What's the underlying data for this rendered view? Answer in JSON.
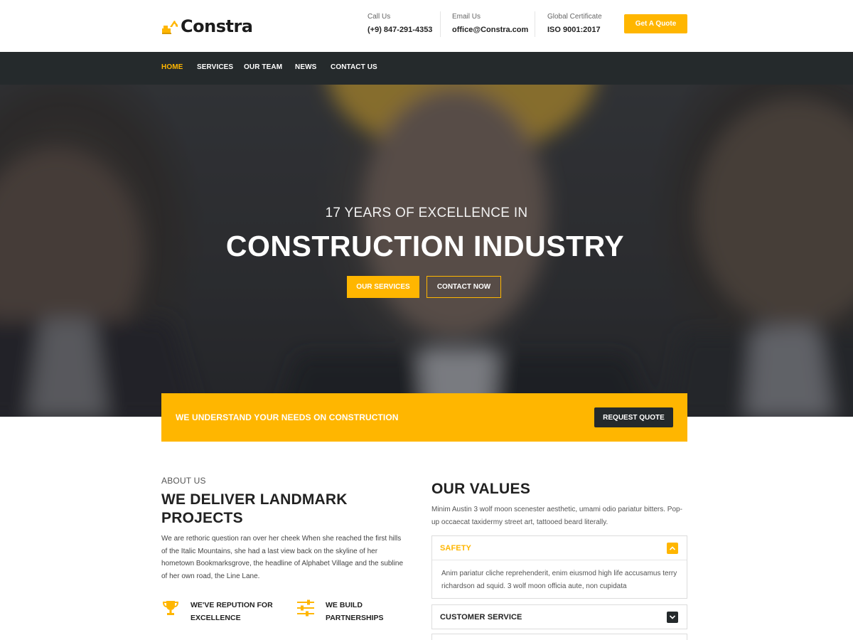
{
  "brand": {
    "name": "Constra",
    "accent": "#ffb600",
    "dark": "#252a2c",
    "icon": "excavator-logo-icon"
  },
  "contact": [
    {
      "label": "Call Us",
      "value": "(+9) 847-291-4353"
    },
    {
      "label": "Email Us",
      "value": "office@Constra.com"
    },
    {
      "label": "Global Certificate",
      "value": "ISO 9001:2017"
    }
  ],
  "header": {
    "quote_label": "Get A Quote"
  },
  "nav": {
    "items": [
      {
        "label": "HOME",
        "active": true
      },
      {
        "label": "SERVICES",
        "active": false
      },
      {
        "label": "OUR TEAM",
        "active": false
      },
      {
        "label": "NEWS",
        "active": false
      },
      {
        "label": "CONTACT US",
        "active": false
      }
    ]
  },
  "hero": {
    "subtitle": "17 YEARS OF EXCELLENCE IN",
    "title": "CONSTRUCTION INDUSTRY",
    "primary_button": "OUR SERVICES",
    "secondary_button": "CONTACT NOW"
  },
  "cta": {
    "text": "WE UNDERSTAND YOUR NEEDS ON CONSTRUCTION",
    "button": "REQUEST QUOTE"
  },
  "about": {
    "kicker": "ABOUT US",
    "title": "WE DELIVER LANDMARK PROJECTS",
    "body": "We are rethoric question ran over her cheek When she reached the first hills of the Italic Mountains, she had a last view back on the skyline of her hometown Bookmarksgrove, the headline of Alphabet Village and the subline of her own road, the Line Lane.",
    "features": [
      {
        "icon": "trophy-icon",
        "line1": "WE'VE REPUTION FOR",
        "line2": "EXCELLENCE"
      },
      {
        "icon": "sliders-icon",
        "line1": "WE BUILD",
        "line2": "PARTNERSHIPS"
      }
    ]
  },
  "values": {
    "title": "OUR VALUES",
    "body": "Minim Austin 3 wolf moon scenester aesthetic, umami odio pariatur bitters. Pop-up occaecat taxidermy street art, tattooed beard literally.",
    "accordion": [
      {
        "label": "SAFETY",
        "open": true,
        "content": "Anim pariatur cliche reprehenderit, enim eiusmod high life accusamus terry richardson ad squid. 3 wolf moon officia aute, non cupidata"
      },
      {
        "label": "CUSTOMER SERVICE",
        "open": false
      }
    ]
  }
}
